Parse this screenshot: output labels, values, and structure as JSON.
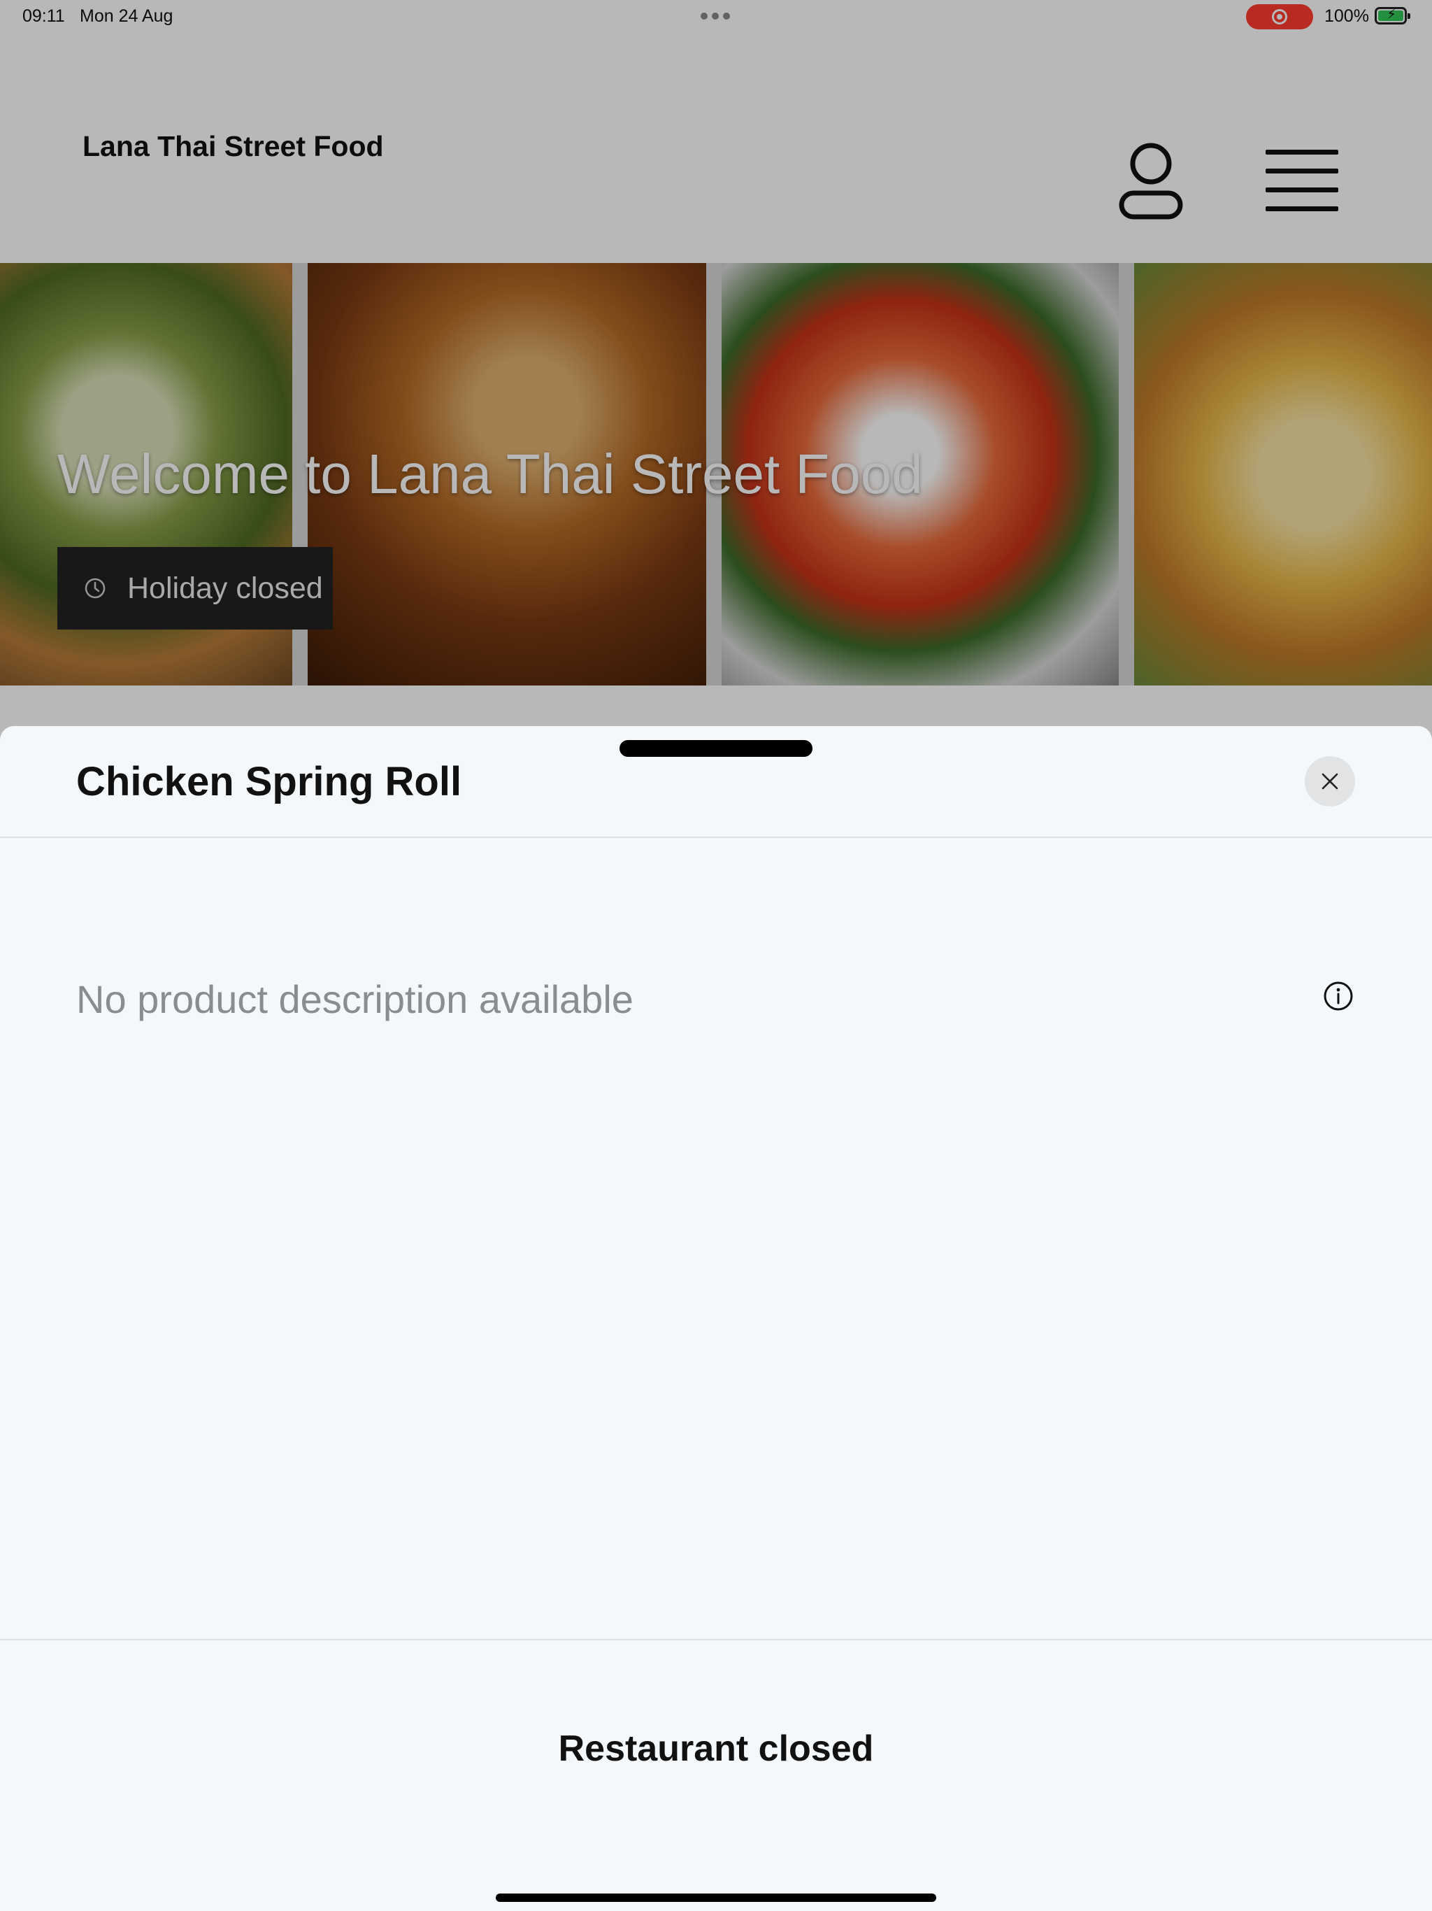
{
  "status_bar": {
    "time": "09:11",
    "date": "Mon 24 Aug",
    "battery": "100%",
    "recording_color": "#ff3b30",
    "battery_color": "#34c759"
  },
  "header": {
    "site_title": "Lana Thai Street Food",
    "profile_icon": "person-outline-icon",
    "menu_icon": "hamburger-menu-icon"
  },
  "hero": {
    "title": "Welcome to Lana Thai Street Food",
    "badge": "Holiday closed",
    "badge_icon": "clock-icon"
  },
  "product_sheet": {
    "title": "Chicken Spring Roll",
    "description": "No product description available",
    "footer_status": "Restaurant closed",
    "close_icon": "close-icon",
    "info_icon": "info-icon"
  }
}
